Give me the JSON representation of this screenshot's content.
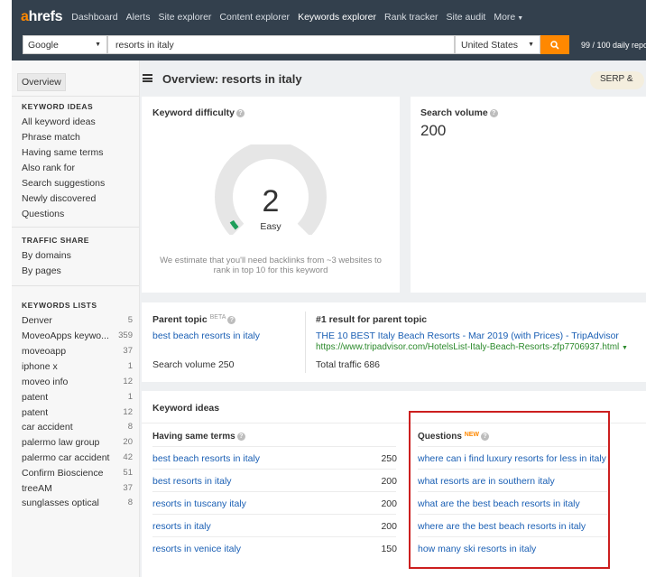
{
  "nav": {
    "logo_a": "a",
    "logo_rest": "hrefs",
    "items": [
      "Dashboard",
      "Alerts",
      "Site explorer",
      "Content explorer",
      "Keywords explorer",
      "Rank tracker",
      "Site audit",
      "More"
    ]
  },
  "search": {
    "engine": "Google",
    "query": "resorts in italy",
    "country": "United States",
    "usage": "99 / 100 daily repor"
  },
  "sidebar": {
    "overview": "Overview",
    "keyword_ideas_title": "KEYWORD IDEAS",
    "keyword_ideas": [
      "All keyword ideas",
      "Phrase match",
      "Having same terms",
      "Also rank for",
      "Search suggestions",
      "Newly discovered",
      "Questions"
    ],
    "traffic_share_title": "TRAFFIC SHARE",
    "traffic_share": [
      "By domains",
      "By pages"
    ],
    "keywords_lists_title": "KEYWORDS LISTS",
    "keywords_lists": [
      {
        "name": "Denver",
        "count": "5"
      },
      {
        "name": "MoveoApps keywo...",
        "count": "359"
      },
      {
        "name": "moveoapp",
        "count": "37"
      },
      {
        "name": "iphone x",
        "count": "1"
      },
      {
        "name": "moveo info",
        "count": "12"
      },
      {
        "name": "patent",
        "count": "1"
      },
      {
        "name": "patent",
        "count": "12"
      },
      {
        "name": "car accident",
        "count": "8"
      },
      {
        "name": "palermo law group",
        "count": "20"
      },
      {
        "name": "palermo car accident",
        "count": "42"
      },
      {
        "name": "Confirm Bioscience",
        "count": "51"
      },
      {
        "name": "treeAM",
        "count": "37"
      },
      {
        "name": "sunglasses optical",
        "count": "8"
      }
    ]
  },
  "header": {
    "title": "Overview: resorts in italy",
    "serp_button": "SERP &"
  },
  "difficulty": {
    "title": "Keyword difficulty",
    "value": "2",
    "label": "Easy",
    "note": "We estimate that you'll need backlinks from ~3 websites to rank in top 10 for this keyword",
    "gauge_level": 0.02
  },
  "volume": {
    "title": "Search volume",
    "value": "200"
  },
  "parent_topic": {
    "title": "Parent topic",
    "beta": "BETA",
    "topic": "best beach resorts in italy",
    "volume_text": "Search volume 250",
    "result_title": "#1 result for parent topic",
    "result_link": "THE 10 BEST Italy Beach Resorts - Mar 2019 (with Prices) - TripAdvisor",
    "result_url": "https://www.tripadvisor.com/HotelsList-Italy-Beach-Resorts-zfp7706937.html",
    "traffic_text": "Total traffic 686"
  },
  "keyword_ideas": {
    "title": "Keyword ideas",
    "same_terms_title": "Having same terms",
    "same_terms": [
      {
        "keyword": "best beach resorts in italy",
        "volume": "250"
      },
      {
        "keyword": "best resorts in italy",
        "volume": "200"
      },
      {
        "keyword": "resorts in tuscany italy",
        "volume": "200"
      },
      {
        "keyword": "resorts in italy",
        "volume": "200"
      },
      {
        "keyword": "resorts in venice italy",
        "volume": "150"
      }
    ],
    "questions_title": "Questions",
    "new_tag": "NEW",
    "questions": [
      "where can i find luxury resorts for less in italy",
      "what resorts are in southern italy",
      "what are the best beach resorts in italy",
      "where are the best beach resorts in italy",
      "how many ski resorts in italy"
    ]
  },
  "colors": {
    "accent": "#ff8800",
    "nav_bg": "#33404d",
    "link": "#1a5fb4",
    "gauge_fill": "#1e9e5a",
    "highlight": "#cc1f1f"
  }
}
